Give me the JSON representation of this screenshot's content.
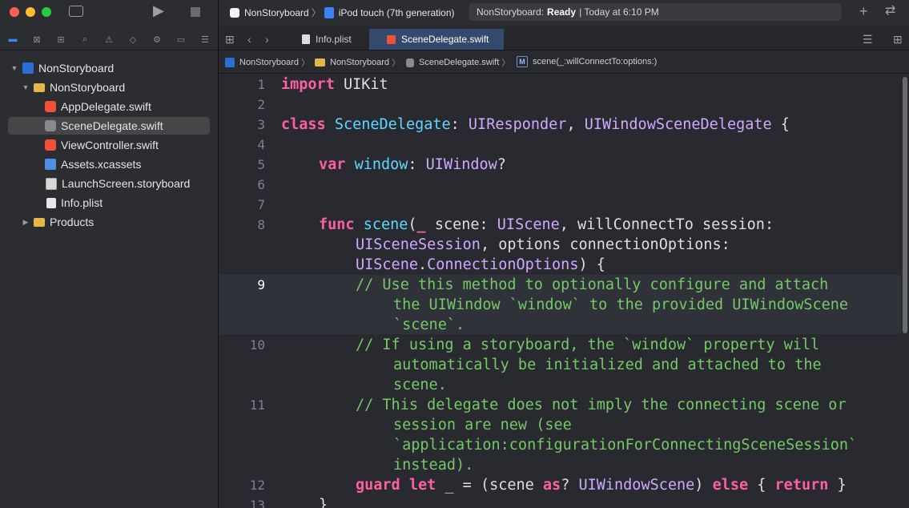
{
  "sidebar": {
    "tree": [
      {
        "label": "NonStoryboard",
        "type": "project",
        "expanded": true
      },
      {
        "label": "NonStoryboard",
        "type": "folder",
        "expanded": true
      },
      {
        "label": "AppDelegate.swift",
        "type": "swift"
      },
      {
        "label": "SceneDelegate.swift",
        "type": "swift",
        "selected": true
      },
      {
        "label": "ViewController.swift",
        "type": "swift"
      },
      {
        "label": "Assets.xcassets",
        "type": "assets"
      },
      {
        "label": "LaunchScreen.storyboard",
        "type": "storyboard"
      },
      {
        "label": "Info.plist",
        "type": "plist"
      },
      {
        "label": "Products",
        "type": "folder",
        "expanded": false
      }
    ]
  },
  "toolbar": {
    "scheme_app": "NonStoryboard",
    "scheme_device": "iPod touch (7th generation)",
    "status_prefix": "NonStoryboard:",
    "status_state": "Ready",
    "status_time": "| Today at 6:10 PM"
  },
  "tabs": [
    {
      "label": "Info.plist",
      "active": false
    },
    {
      "label": "SceneDelegate.swift",
      "active": true
    }
  ],
  "breadcrumb": [
    "NonStoryboard",
    "NonStoryboard",
    "SceneDelegate.swift",
    "scene(_:willConnectTo:options:)"
  ],
  "editor": {
    "current_line": 9,
    "line_numbers": [
      "1",
      "2",
      "3",
      "4",
      "5",
      "6",
      "7",
      "8",
      "9",
      "10",
      "11",
      "12",
      "13"
    ],
    "code": {
      "l1_kw": "import",
      "l1_rest": " UIKit",
      "l3_kw": "class",
      "l3_name": "SceneDelegate",
      "l3_c1": ": ",
      "l3_t1": "UIResponder",
      "l3_c2": ", ",
      "l3_t2": "UIWindowSceneDelegate",
      "l3_c3": " {",
      "l5_kw": "var",
      "l5_name": "window",
      "l5_c1": ": ",
      "l5_t1": "UIWindow",
      "l5_c2": "?",
      "l8_kw": "func",
      "l8_name": "scene",
      "l8_c1": "(",
      "l8_kw2": "_",
      "l8_c2": " scene: ",
      "l8_t1": "UIScene",
      "l8_c3": ", willConnectTo session:",
      "l8b_t1": "UISceneSession",
      "l8b_c1": ", options connectionOptions:",
      "l8c_t1": "UIScene",
      "l8c_c1": ".",
      "l8c_t2": "ConnectionOptions",
      "l8c_c2": ") {",
      "l9a": "// Use this method to optionally configure and attach",
      "l9b": "the UIWindow `window` to the provided UIWindowScene",
      "l9c": "`scene`.",
      "l10a": "// If using a storyboard, the `window` property will",
      "l10b": "automatically be initialized and attached to the",
      "l10c": "scene.",
      "l11a": "// This delegate does not imply the connecting scene or",
      "l11b": "session are new (see",
      "l11c": "`application:configurationForConnectingSceneSession`",
      "l11d": "instead).",
      "l12_kw1": "guard",
      "l12_s1": " ",
      "l12_kw2": "let",
      "l12_c1": " _ = (scene ",
      "l12_kw3": "as",
      "l12_c2": "? ",
      "l12_t1": "UIWindowScene",
      "l12_c3": ") ",
      "l12_kw4": "else",
      "l12_c4": " { ",
      "l12_kw5": "return",
      "l12_c5": " }",
      "l13": "}"
    }
  },
  "colors": {
    "keyword": "#fc5fa3",
    "type": "#d0a8ff",
    "declaration": "#5dd8ff",
    "comment": "#74c966",
    "selection": "#464649",
    "active_tab": "#34496e"
  }
}
